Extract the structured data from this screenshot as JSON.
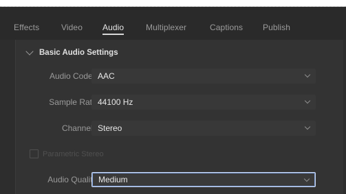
{
  "tabs": [
    {
      "label": "Effects",
      "active": false
    },
    {
      "label": "Video",
      "active": false
    },
    {
      "label": "Audio",
      "active": true
    },
    {
      "label": "Multiplexer",
      "active": false
    },
    {
      "label": "Captions",
      "active": false
    },
    {
      "label": "Publish",
      "active": false
    }
  ],
  "section": {
    "title": "Basic Audio Settings",
    "icon": "chevron-down-icon"
  },
  "fields": {
    "audio_codec": {
      "label": "Audio Codec:",
      "value": "AAC"
    },
    "sample_rate": {
      "label": "Sample Rate:",
      "value": "44100 Hz"
    },
    "channels": {
      "label": "Channels:",
      "value": "Stereo"
    },
    "parametric_stereo": {
      "label": "Parametric Stereo",
      "checked": false,
      "enabled": false
    },
    "audio_quality": {
      "label": "Audio Quality:",
      "value": "Medium"
    }
  },
  "colors": {
    "background": "#2d2d2d",
    "focus_outline": "#c9d7f0",
    "text_primary": "#e8e8e8",
    "text_muted": "#9a9a9a"
  }
}
